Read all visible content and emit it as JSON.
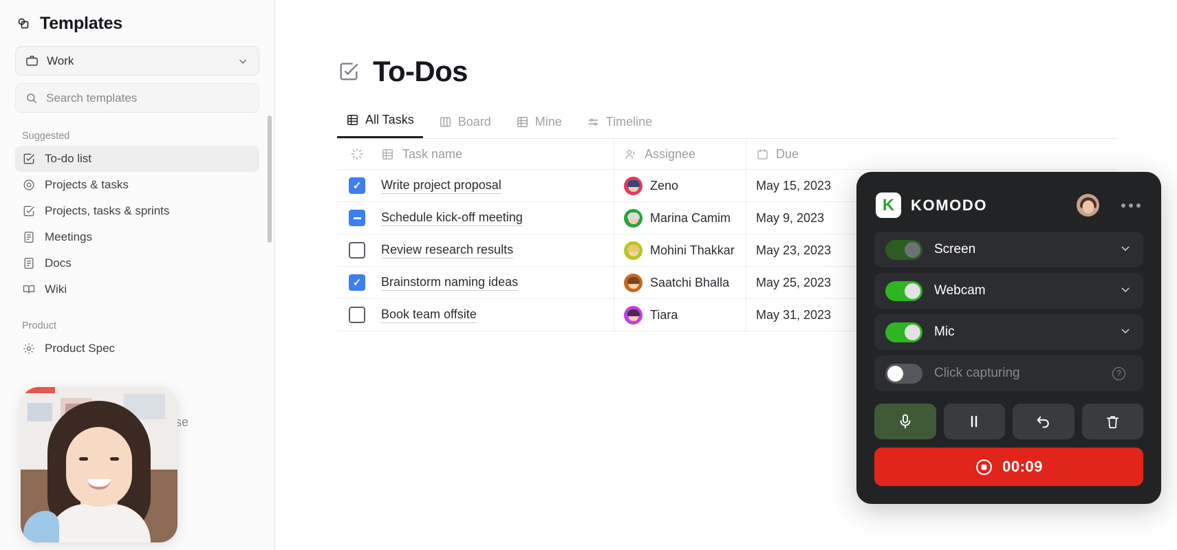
{
  "sidebar": {
    "title": "Templates",
    "workspace": {
      "label": "Work",
      "icon": "briefcase-icon",
      "chevron": "chevron-down-icon"
    },
    "search": {
      "placeholder": "Search templates",
      "value": ""
    },
    "sections": [
      {
        "label": "Suggested",
        "items": [
          {
            "label": "To-do list",
            "icon": "checkbox-check-icon",
            "active": true
          },
          {
            "label": "Projects & tasks",
            "icon": "target-icon",
            "active": false
          },
          {
            "label": "Projects, tasks & sprints",
            "icon": "checkbox-check-icon",
            "active": false
          },
          {
            "label": "Meetings",
            "icon": "doc-lines-icon",
            "active": false
          },
          {
            "label": "Docs",
            "icon": "doc-lines-icon",
            "active": false
          },
          {
            "label": "Wiki",
            "icon": "book-open-icon",
            "active": false
          }
        ]
      },
      {
        "label": "Product",
        "items": [
          {
            "label": "Product Spec",
            "icon": "gear-icon",
            "active": false
          }
        ]
      }
    ],
    "obscured_fragments": [
      "ase"
    ]
  },
  "main": {
    "page_icon": "checkbox-check-icon",
    "page_title": "To-Dos",
    "tabs": [
      {
        "label": "All Tasks",
        "icon": "grid-icon",
        "active": true
      },
      {
        "label": "Board",
        "icon": "columns-icon",
        "active": false
      },
      {
        "label": "Mine",
        "icon": "table-icon",
        "active": false
      },
      {
        "label": "Timeline",
        "icon": "timeline-icon",
        "active": false
      }
    ],
    "table": {
      "columns": [
        {
          "key": "status",
          "label": "",
          "icon": "loading-spinner-icon"
        },
        {
          "key": "task",
          "label": "Task name",
          "icon": "grid-icon"
        },
        {
          "key": "assignee",
          "label": "Assignee",
          "icon": "person-icon"
        },
        {
          "key": "due",
          "label": "Due",
          "icon": "calendar-icon"
        }
      ],
      "rows": [
        {
          "state": "checked",
          "task": "Write project proposal",
          "assignee": "Zeno",
          "due": "May 15, 2023",
          "avatar_color": "#e03a5f",
          "hair_color": "#2f4a7a"
        },
        {
          "state": "indeterminate",
          "task": "Schedule kick-off meeting",
          "assignee": "Marina Camim",
          "due": "May 9, 2023",
          "avatar_color": "#27a53c",
          "hair_color": "#d8d8d8"
        },
        {
          "state": "unchecked",
          "task": "Review research results",
          "assignee": "Mohini Thakkar",
          "due": "May 23, 2023",
          "avatar_color": "#b6c520",
          "hair_color": "#e8c96a"
        },
        {
          "state": "checked",
          "task": "Brainstorm naming ideas",
          "assignee": "Saatchi Bhalla",
          "due": "May 25, 2023",
          "avatar_color": "#c7681f",
          "hair_color": "#7a4420"
        },
        {
          "state": "unchecked",
          "task": "Book team offsite",
          "assignee": "Tiara",
          "due": "May 31, 2023",
          "avatar_color": "#c43ee0",
          "hair_color": "#4a2a5a"
        }
      ]
    }
  },
  "komodo": {
    "brand": "KOMODO",
    "logo_letter": "K",
    "avatar": "user-avatar",
    "menu_icon": "more-dots-icon",
    "toggles": [
      {
        "label": "Screen",
        "state": "dim",
        "has_chevron": true,
        "has_help": false
      },
      {
        "label": "Webcam",
        "state": "on",
        "has_chevron": true,
        "has_help": false
      },
      {
        "label": "Mic",
        "state": "on",
        "has_chevron": true,
        "has_help": false
      },
      {
        "label": "Click capturing",
        "state": "off",
        "has_chevron": false,
        "has_help": true
      }
    ],
    "buttons": [
      {
        "name": "mic-button",
        "icon": "microphone-icon",
        "highlight": true
      },
      {
        "name": "pause-button",
        "icon": "pause-icon",
        "highlight": false
      },
      {
        "name": "undo-button",
        "icon": "undo-arrow-icon",
        "highlight": false
      },
      {
        "name": "delete-button",
        "icon": "trash-icon",
        "highlight": false
      }
    ],
    "record": {
      "icon": "stop-record-icon",
      "timer": "00:09",
      "color": "#e1251b"
    }
  }
}
